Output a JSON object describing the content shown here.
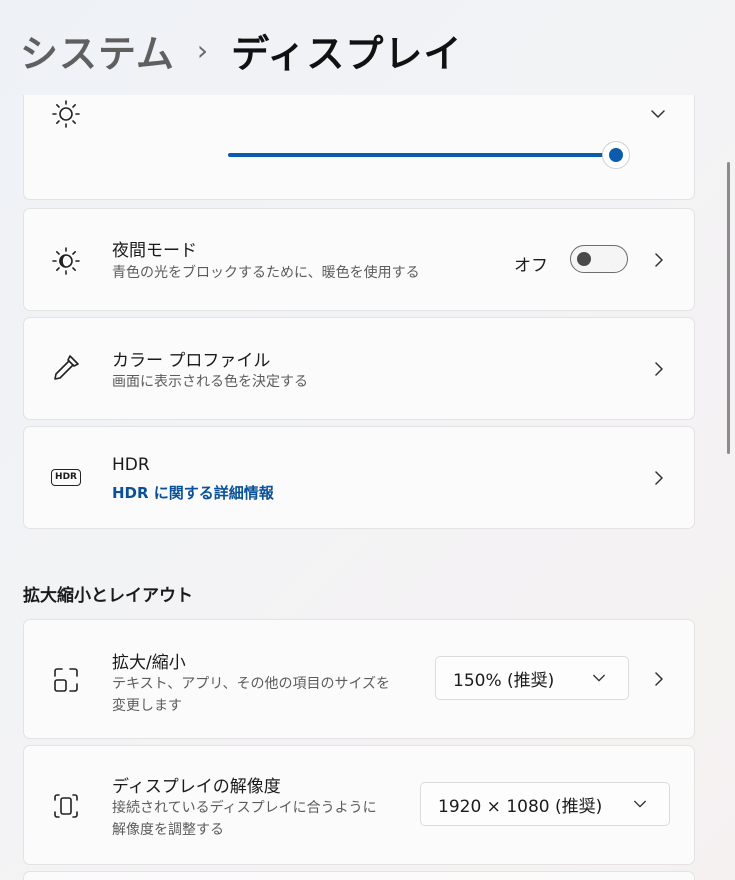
{
  "breadcrumb": {
    "parent": "システム",
    "separator": "›",
    "current": "ディスプレイ"
  },
  "brightness": {
    "slider_value_percent": 100
  },
  "night_light": {
    "title": "夜間モード",
    "description": "青色の光をブロックするために、暖色を使用する",
    "toggle_label": "オフ",
    "toggle_on": false
  },
  "color_profile": {
    "title": "カラー プロファイル",
    "description": "画面に表示される色を決定する"
  },
  "hdr": {
    "title": "HDR",
    "icon_text": "HDR",
    "link": "HDR に関する詳細情報"
  },
  "scale_layout": {
    "section_title": "拡大縮小とレイアウト",
    "scale": {
      "title": "拡大/縮小",
      "description_line1": "テキスト、アプリ、その他の項目のサイズを",
      "description_line2": "変更します",
      "selected": "150% (推奨)"
    },
    "resolution": {
      "title": "ディスプレイの解像度",
      "description_line1": "接続されているディスプレイに合うように",
      "description_line2": "解像度を調整する",
      "selected": "1920 × 1080 (推奨)"
    }
  },
  "colors": {
    "accent": "#0b5cad",
    "link": "#0a5198"
  }
}
